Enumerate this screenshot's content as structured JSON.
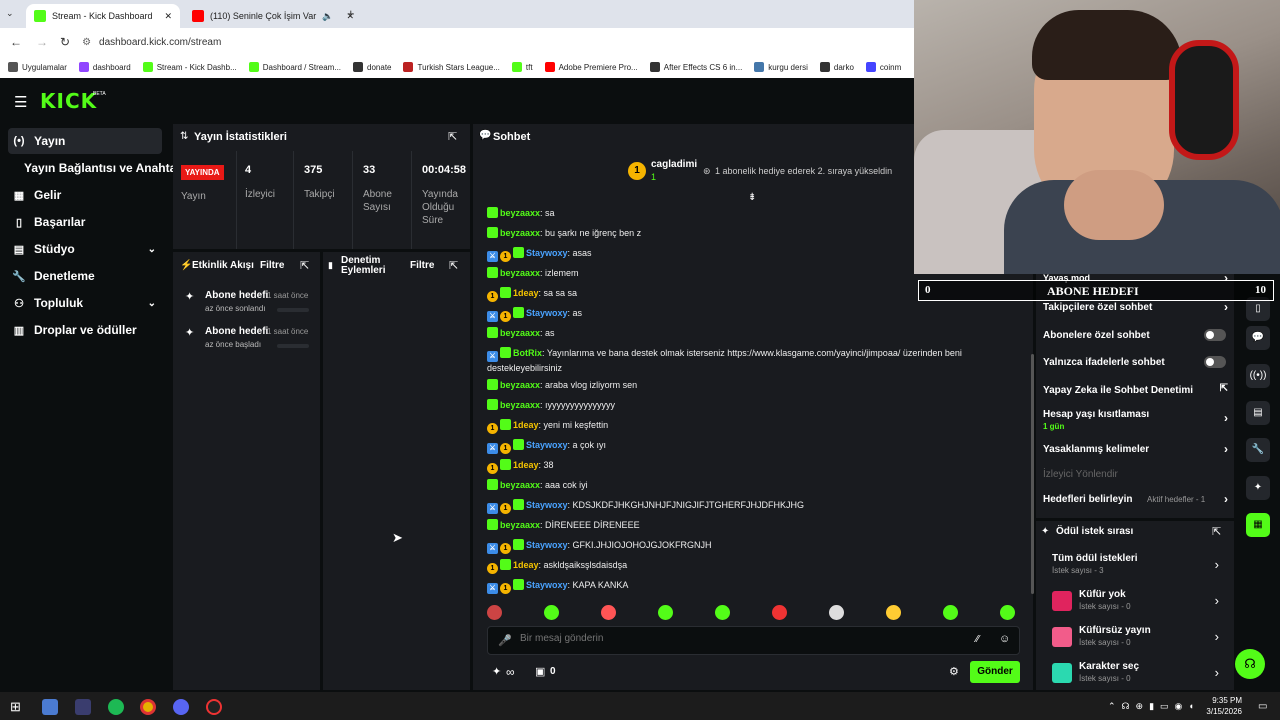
{
  "browser": {
    "tabs": [
      {
        "title": "Stream - Kick Dashboard",
        "active": true
      },
      {
        "title": "(110) Seninle Çok İşim Var",
        "active": false
      }
    ],
    "url": "dashboard.kick.com/stream",
    "bookmarks": [
      "Uygulamalar",
      "dashboard",
      "Stream - Kick Dashb...",
      "Dashboard / Stream...",
      "donate",
      "Turkish Stars League...",
      "tft",
      "Adobe Premiere Pro...",
      "After Effects CS 6 in...",
      "kurgu dersi",
      "darko",
      "coinm"
    ]
  },
  "brand": {
    "logo": "KICK",
    "beta": "BETA",
    "accent": "#53fc18"
  },
  "sidebar": {
    "items": [
      {
        "label": "Yayın",
        "icon": "broadcast-icon",
        "active": true
      },
      {
        "label": "Yayın Bağlantısı ve Anahtarı",
        "icon": "",
        "active": false
      },
      {
        "label": "Gelir",
        "icon": "money-icon",
        "active": false
      },
      {
        "label": "Başarılar",
        "icon": "trophy-icon",
        "active": false
      },
      {
        "label": "Stüdyo",
        "icon": "studio-icon",
        "active": false
      },
      {
        "label": "Denetleme",
        "icon": "wrench-icon",
        "active": false
      },
      {
        "label": "Topluluk",
        "icon": "people-icon",
        "active": false
      },
      {
        "label": "Droplar ve ödüller",
        "icon": "gift-icon",
        "active": false
      }
    ]
  },
  "stats": {
    "title": "Yayın İstatistikleri",
    "live": "YAYINDA",
    "live_label": "Yayın",
    "viewers": "4",
    "viewers_label": "İzleyici",
    "followers": "375",
    "followers_label": "Takipçi",
    "subs": "33",
    "subs_label": "Abone Sayısı",
    "duration": "00:04:58",
    "duration_label": "Yayında Olduğu Süre"
  },
  "activity": {
    "title": "Etkinlik Akışı",
    "filter": "Filtre",
    "items": [
      {
        "title": "Abone hedefi",
        "time": "1 saat önce",
        "desc": "az önce sonlandı"
      },
      {
        "title": "Abone hedefi",
        "time": "1 saat önce",
        "desc": "az önce başladı"
      }
    ]
  },
  "moderation": {
    "title": "Denetim Eylemleri",
    "filter": "Filtre"
  },
  "chat": {
    "title": "Sohbet",
    "pinned": {
      "user": "cagladimi",
      "rank": "1",
      "count": "1",
      "text": "1 abonelik hediye ederek 2. sıraya yükseldin"
    },
    "messages": [
      {
        "user": "beyzaaxx",
        "type": "u1",
        "badges": [
          "g"
        ],
        "text": "sa"
      },
      {
        "user": "beyzaaxx",
        "type": "u1",
        "badges": [
          "g"
        ],
        "text": "bu şarkı ne iğrenç ben z"
      },
      {
        "user": "Staywoxy",
        "type": "u2",
        "badges": [
          "mod",
          "sub",
          "g"
        ],
        "text": "asas"
      },
      {
        "user": "beyzaaxx",
        "type": "u1",
        "badges": [
          "g"
        ],
        "text": "izlemem"
      },
      {
        "user": "1deay",
        "type": "u3",
        "badges": [
          "sub",
          "g"
        ],
        "text": "sa sa sa"
      },
      {
        "user": "Staywoxy",
        "type": "u2",
        "badges": [
          "mod",
          "sub",
          "g"
        ],
        "text": "as"
      },
      {
        "user": "beyzaaxx",
        "type": "u1",
        "badges": [
          "g"
        ],
        "text": "as"
      },
      {
        "user": "BotRix",
        "type": "u1",
        "badges": [
          "mod",
          "g"
        ],
        "text": "Yayınlarıma ve bana destek olmak isterseniz https://www.klasgame.com/yayinci/jimpoaa/ üzerinden beni destekleyebilirsiniz"
      },
      {
        "user": "beyzaaxx",
        "type": "u1",
        "badges": [
          "g"
        ],
        "text": "araba vlog izliyorm sen"
      },
      {
        "user": "beyzaaxx",
        "type": "u1",
        "badges": [
          "g"
        ],
        "text": "ıyyyyyyyyyyyyyyy"
      },
      {
        "user": "1deay",
        "type": "u3",
        "badges": [
          "sub",
          "g"
        ],
        "text": "yeni mi keşfettin"
      },
      {
        "user": "Staywoxy",
        "type": "u2",
        "badges": [
          "mod",
          "sub",
          "g"
        ],
        "text": "a çok ıyı"
      },
      {
        "user": "1deay",
        "type": "u3",
        "badges": [
          "sub",
          "g"
        ],
        "text": "38"
      },
      {
        "user": "beyzaaxx",
        "type": "u1",
        "badges": [
          "g"
        ],
        "text": "aaa cok iyi"
      },
      {
        "user": "Staywoxy",
        "type": "u2",
        "badges": [
          "mod",
          "sub",
          "g"
        ],
        "text": "KDSJKDFJHKGHJNHJFJNIGJIFJTGHERFJHJDFHKJHG"
      },
      {
        "user": "beyzaaxx",
        "type": "u1",
        "badges": [
          "g"
        ],
        "text": "DİRENEEE DİRENEEE"
      },
      {
        "user": "Staywoxy",
        "type": "u2",
        "badges": [
          "mod",
          "sub",
          "g"
        ],
        "text": "GFKI.JHJIOJOHOJGJOKFRGNJH"
      },
      {
        "user": "1deay",
        "type": "u3",
        "badges": [
          "sub",
          "g"
        ],
        "text": "askldşaiksşlsdaisdşa"
      },
      {
        "user": "Staywoxy",
        "type": "u2",
        "badges": [
          "mod",
          "sub",
          "g"
        ],
        "text": "KAPA KANKA"
      }
    ],
    "placeholder": "Bir mesaj gönderin",
    "points": "∞",
    "gift_count": "0",
    "send": "Gönder"
  },
  "settings": {
    "rows": [
      {
        "label": "Yavaş mod",
        "control": "arrow"
      },
      {
        "label": "Takipçilere özel sohbet",
        "control": "arrow"
      },
      {
        "label": "Abonelere özel sohbet",
        "control": "toggle"
      },
      {
        "label": "Yalnızca ifadelerle sohbet",
        "control": "toggle"
      },
      {
        "label": "Yapay Zeka ile Sohbet Denetimi",
        "control": "ext"
      },
      {
        "label": "Hesap yaşı kısıtlaması",
        "sub": "1 gün",
        "control": "arrow"
      },
      {
        "label": "Yasaklanmış kelimeler",
        "control": "arrow"
      },
      {
        "label": "İzleyici Yönlendir",
        "control": "none"
      },
      {
        "label": "Hedefleri belirleyin",
        "extra": "Aktif hedefler - 1",
        "control": "arrow"
      }
    ]
  },
  "rewards": {
    "title": "Ödül istek sırası",
    "items": [
      {
        "title": "Tüm ödül istekleri",
        "sub": "İstek sayısı - 3",
        "color": ""
      },
      {
        "title": "Küfür yok",
        "sub": "İstek sayısı - 0",
        "color": "#e0245e"
      },
      {
        "title": "Küfürsüz yayın",
        "sub": "İstek sayısı - 0",
        "color": "#f25c8a"
      },
      {
        "title": "Karakter seç",
        "sub": "İstek sayısı - 0",
        "color": "#2bd9b0"
      }
    ]
  },
  "overlay": {
    "goal_title": "ABONE HEDEFI",
    "goal_current": "0",
    "goal_target": "10"
  },
  "taskbar": {
    "time": "9:35 PM",
    "date": "3/15/2026"
  }
}
